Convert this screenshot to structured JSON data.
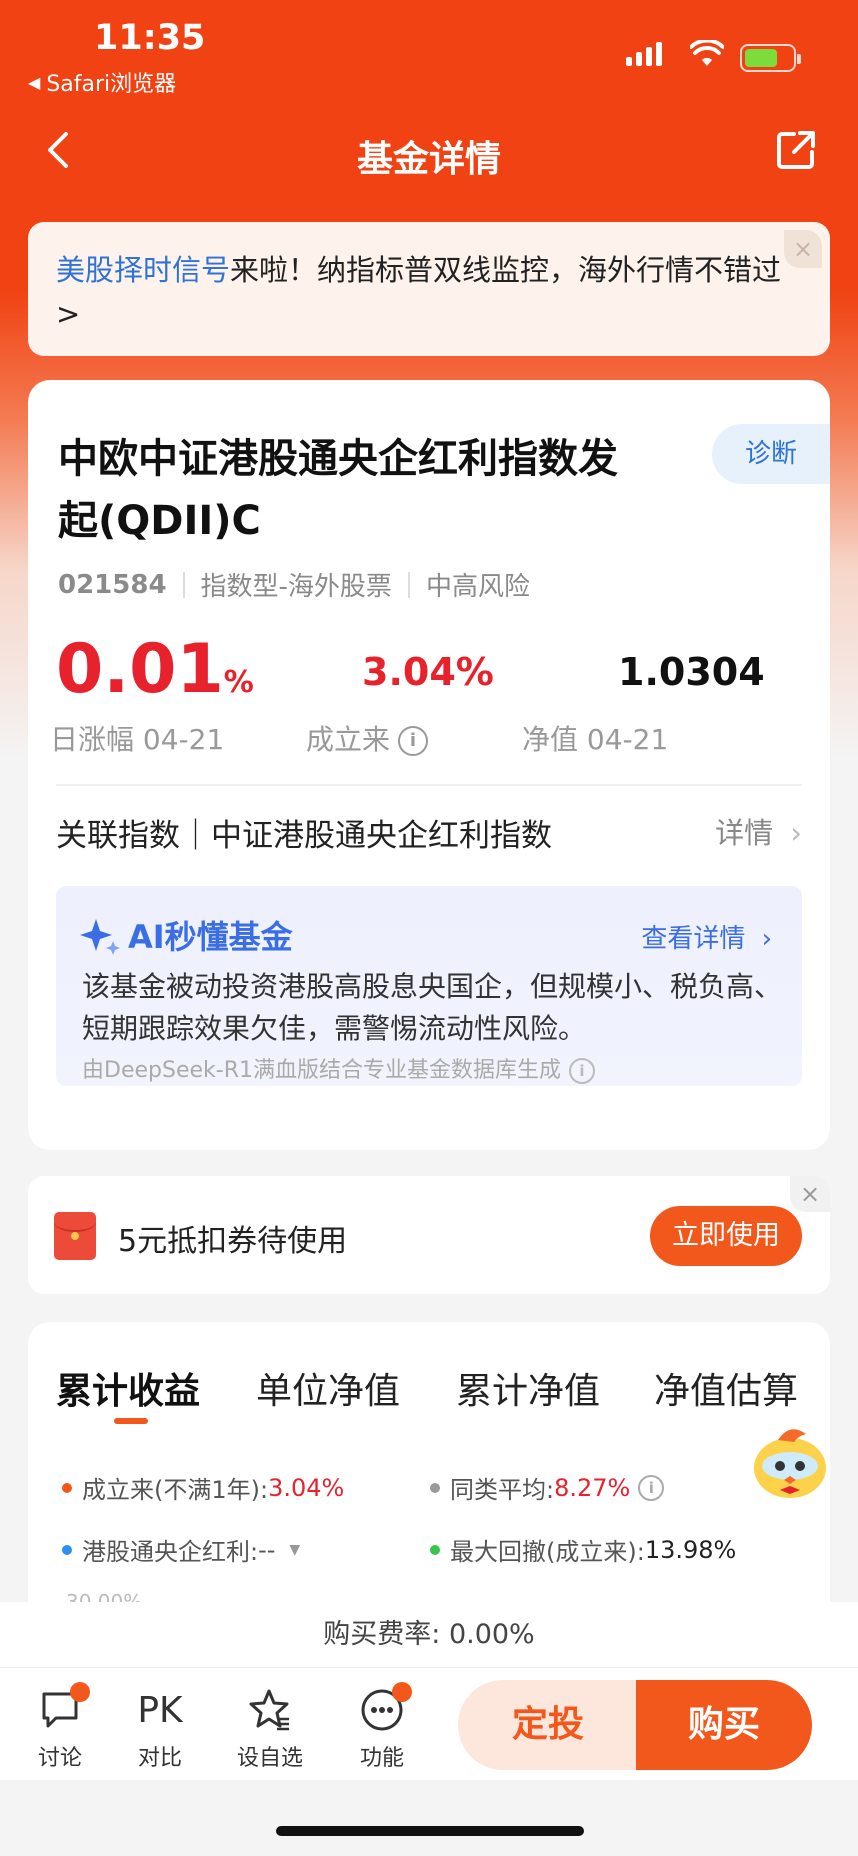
{
  "status_bar": {
    "time": "11:35",
    "back_app": "Safari浏览器"
  },
  "nav": {
    "title": "基金详情"
  },
  "banner": {
    "highlight": "美股择时信号",
    "text": "来啦！纳指标普双线监控，海外行情不错过 >",
    "close": "×"
  },
  "fund": {
    "name": "中欧中证港股通央企红利指数发起(QDII)C",
    "diagnose_label": "诊断",
    "code": "021584",
    "type": "指数型-海外股票",
    "risk": "中高风险",
    "daily_change": "0.01",
    "daily_change_unit": "%",
    "daily_change_label": "日涨幅 04-21",
    "since_inception": "3.04%",
    "since_inception_label": "成立来",
    "nav": "1.0304",
    "nav_label": "净值 04-21",
    "related_index": "关联指数｜中证港股通央企红利指数",
    "related_detail": "详情"
  },
  "ai": {
    "title": "AI秒懂基金",
    "more": "查看详情",
    "text": "该基金被动投资港股高股息央国企，但规模小、税负高、短期跟踪效果欠佳，需警惕流动性风险。",
    "footer": "由DeepSeek-R1满血版结合专业基金数据库生成"
  },
  "coupon": {
    "text": "5元抵扣券待使用",
    "button": "立即使用",
    "close": "×"
  },
  "chart": {
    "tabs": [
      "累计收益",
      "单位净值",
      "累计净值",
      "净值估算"
    ],
    "legend": [
      {
        "label": "成立来(不满1年):",
        "value": "3.04%",
        "color": "#f2581c"
      },
      {
        "label": "同类平均:",
        "value": "8.27%",
        "color": "#999999"
      },
      {
        "label": "港股通央企红利:",
        "value": "--",
        "color": "#2f8ff0"
      },
      {
        "label": "最大回撤(成立来):",
        "value": "13.98%",
        "color": "#3cc44a"
      }
    ],
    "axis_peek": "30.00%"
  },
  "fee": {
    "text": "购买费率: 0.00%"
  },
  "bottom_bar": {
    "items": [
      {
        "label": "讨论",
        "icon": "chat-icon"
      },
      {
        "label": "对比",
        "icon_text": "PK"
      },
      {
        "label": "设自选",
        "icon": "star-icon"
      },
      {
        "label": "功能",
        "icon": "more-icon"
      }
    ],
    "regular_invest": "定投",
    "buy": "购买"
  },
  "colors": {
    "brand": "#f04212",
    "accent": "#f2581c",
    "up": "#e8222d",
    "link": "#2f72d8"
  }
}
